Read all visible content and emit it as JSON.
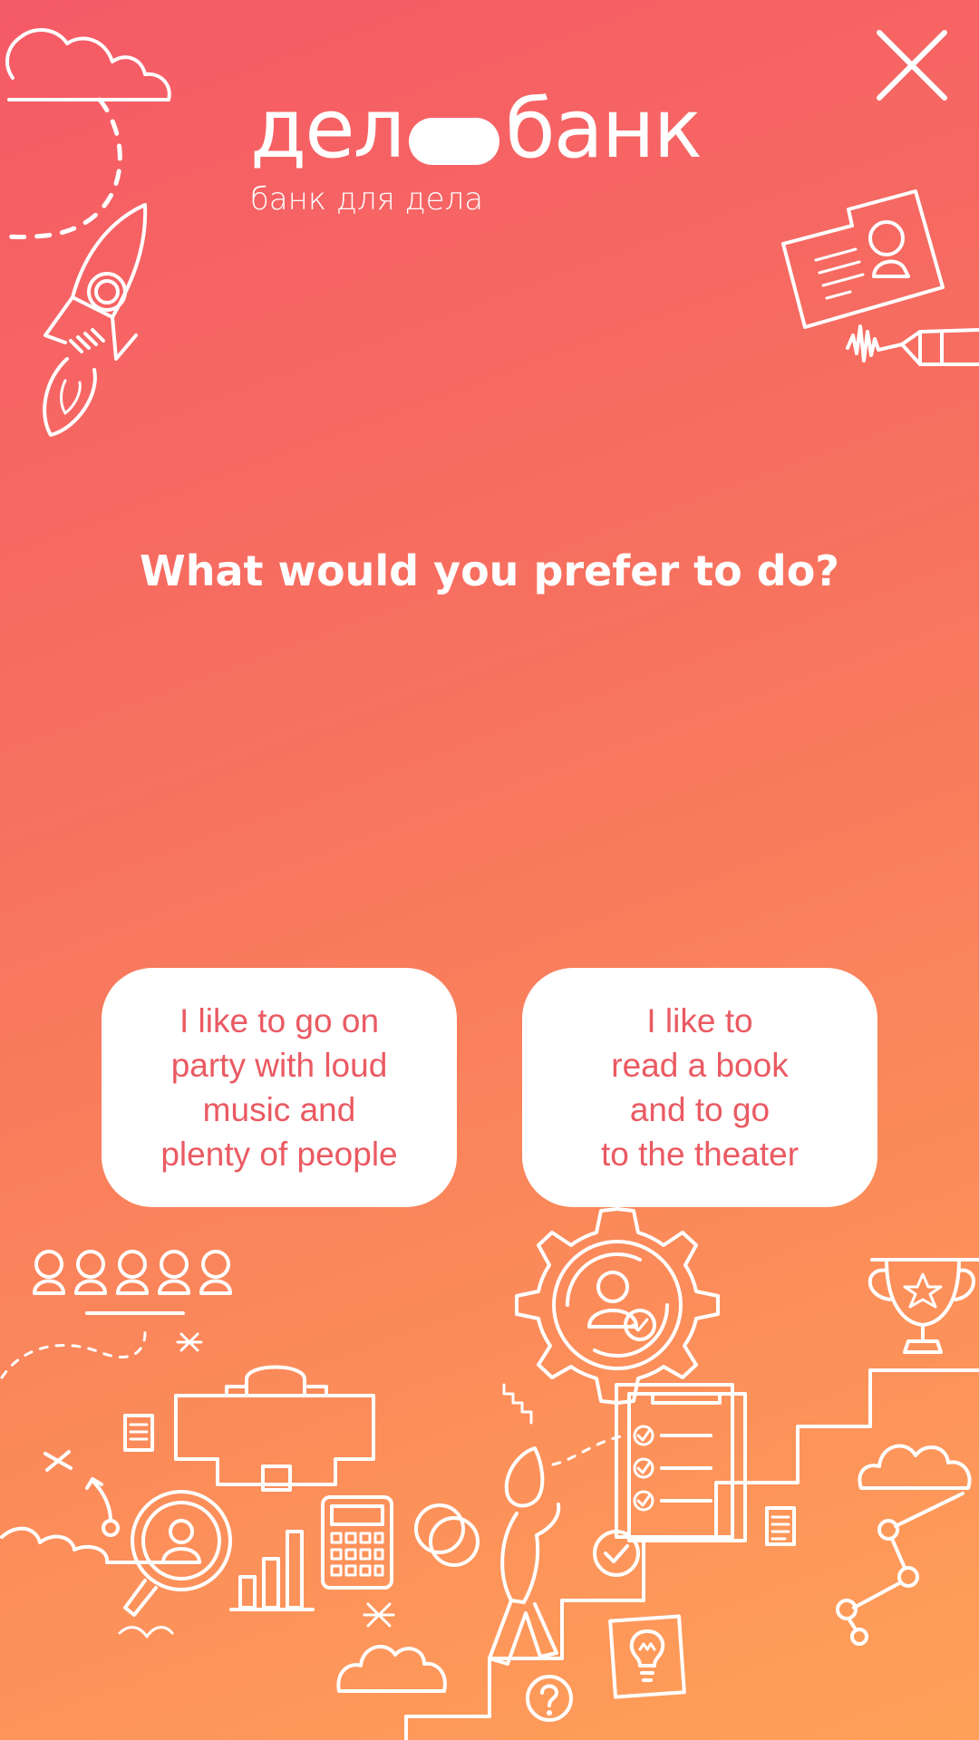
{
  "header": {
    "close_icon": "close-icon",
    "logo": {
      "word_left": "дел",
      "word_right": "банк",
      "tagline": "банк для дела"
    }
  },
  "quiz": {
    "question": "What would you prefer to do?",
    "answers": [
      {
        "label": "I like to go on\nparty with loud\nmusic and\nplenty of people"
      },
      {
        "label": "I like to\nread a book\nand to go\nto the theater"
      }
    ]
  },
  "decorations": [
    "cloud-icon",
    "rocket-icon",
    "id-card-icon",
    "pen-icon",
    "people-row-icon",
    "briefcase-icon",
    "magnifier-icon",
    "bar-chart-icon",
    "calculator-icon",
    "coins-icon",
    "gear-user-icon",
    "checklist-icon",
    "person-climbing-icon",
    "staircase-icon",
    "trophy-icon",
    "document-icon",
    "lightbulb-card-icon",
    "question-mark-icon",
    "network-icon"
  ],
  "colors": {
    "gradient_top": "#f55a67",
    "gradient_bottom": "#ffa159",
    "answer_text": "#ea5a62",
    "card_background": "#ffffff"
  }
}
